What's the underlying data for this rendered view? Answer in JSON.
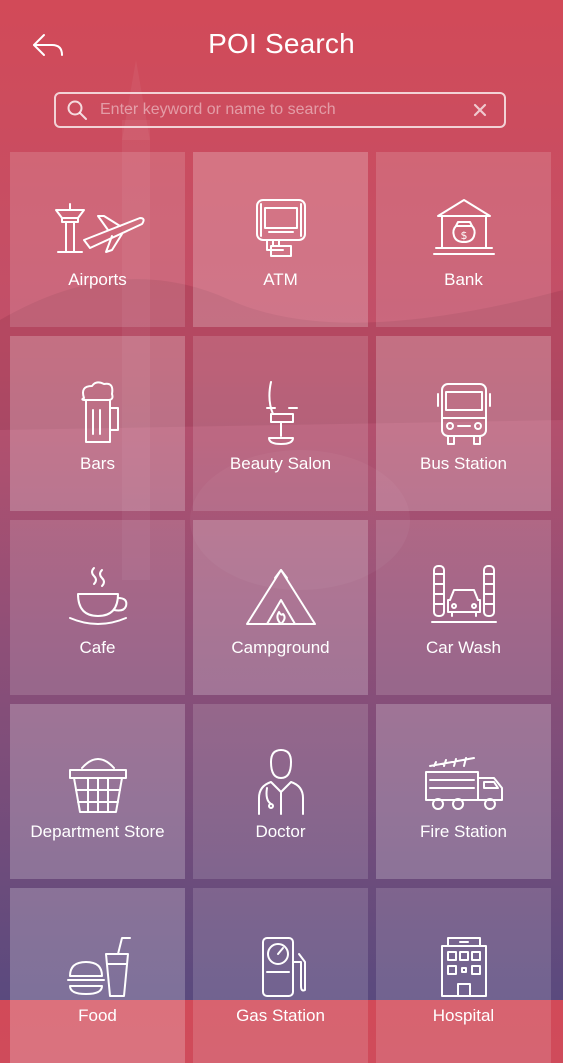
{
  "header": {
    "title": "POI Search"
  },
  "search": {
    "placeholder": "Enter keyword or name to search",
    "value": ""
  },
  "categories": [
    {
      "label": "Airports",
      "icon": "airport-icon"
    },
    {
      "label": "ATM",
      "icon": "atm-icon"
    },
    {
      "label": "Bank",
      "icon": "bank-icon"
    },
    {
      "label": "Bars",
      "icon": "beer-icon"
    },
    {
      "label": "Beauty Salon",
      "icon": "salon-chair-icon"
    },
    {
      "label": "Bus Station",
      "icon": "bus-icon"
    },
    {
      "label": "Cafe",
      "icon": "coffee-cup-icon"
    },
    {
      "label": "Campground",
      "icon": "tent-icon"
    },
    {
      "label": "Car Wash",
      "icon": "car-wash-icon"
    },
    {
      "label": "Department Store",
      "icon": "basket-icon"
    },
    {
      "label": "Doctor",
      "icon": "doctor-icon"
    },
    {
      "label": "Fire Station",
      "icon": "fire-truck-icon"
    },
    {
      "label": "Food",
      "icon": "fast-food-icon"
    },
    {
      "label": "Gas Station",
      "icon": "gas-pump-icon"
    },
    {
      "label": "Hospital",
      "icon": "hospital-icon"
    }
  ],
  "colors": {
    "gradient_top": "#d24a58",
    "gradient_bottom": "#5a4a7e"
  }
}
